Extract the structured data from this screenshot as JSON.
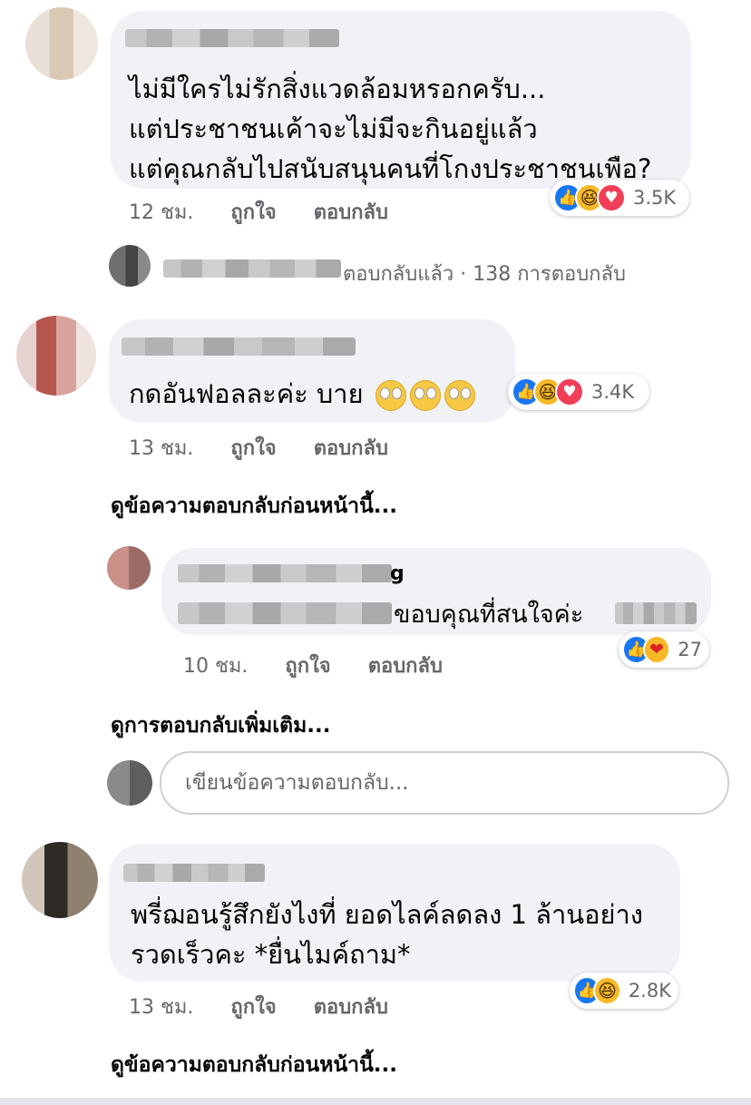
{
  "comments": [
    {
      "text_lines": [
        "ไม่มีใครไม่รักสิ่งแวดล้อมหรอกครับ...",
        "แต่ประชาชนเค้าจะไม่มีจะกินอยู่แล้ว",
        "แต่คุณกลับไปสนับสนุนคนที่โกงประชาชนเพือ?"
      ],
      "time": "12 ชม.",
      "like_label": "ถูกใจ",
      "reply_label": "ตอบกลับ",
      "reactions": [
        "like",
        "haha",
        "love"
      ],
      "reaction_count": "3.5K",
      "replied_summary": "ตอบกลับแล้ว · 138 การตอบกลับ"
    },
    {
      "text": "กดอันฟอลละค่ะ บาย",
      "emojis": [
        "face-with-rolling-eyes",
        "face-with-rolling-eyes",
        "face-with-rolling-eyes"
      ],
      "time": "13 ชม.",
      "like_label": "ถูกใจ",
      "reply_label": "ตอบกลับ",
      "reactions": [
        "like",
        "haha",
        "love"
      ],
      "reaction_count": "3.4K",
      "view_previous": "ดูข้อความตอบกลับก่อนหน้านี้...",
      "reply": {
        "name_tail": "g",
        "text_visible": "ขอบคุณที่สนใจค่ะ",
        "time": "10 ชม.",
        "like_label": "ถูกใจ",
        "reply_label": "ตอบกลับ",
        "reactions": [
          "like",
          "care"
        ],
        "reaction_count": "27"
      },
      "view_more": "ดูการตอบกลับเพิ่มเติม...",
      "reply_box_placeholder": "เขียนข้อความตอบกลับ..."
    },
    {
      "text_lines": [
        "พรี่ฌอนรู้สึกยังไงที่ ยอดไลค์ลดลง 1 ล้านอย่าง",
        "รวดเร็วคะ *ยื่นไมค์ถาม*"
      ],
      "time": "13 ชม.",
      "like_label": "ถูกใจ",
      "reply_label": "ตอบกลับ",
      "reactions": [
        "like",
        "haha"
      ],
      "reaction_count": "2.8K",
      "view_previous": "ดูข้อความตอบกลับก่อนหน้านี้..."
    }
  ],
  "colors": {
    "bubble": "#f0f2f5",
    "meta": "#65676b",
    "like": "#1877f2",
    "love": "#f33e58",
    "haha": "#f7b928"
  }
}
